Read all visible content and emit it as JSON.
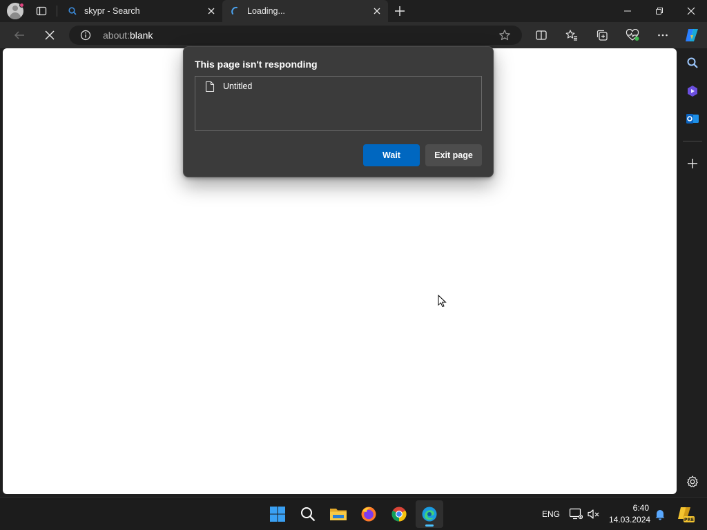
{
  "browser": {
    "tabs": [
      {
        "title": "skypr - Search",
        "favicon": "search-icon",
        "active": false
      },
      {
        "title": "Loading...",
        "favicon": "loading-spinner-icon",
        "active": true
      }
    ],
    "address": {
      "protocol": "about:",
      "rest": "blank"
    },
    "accent": "#0067c0"
  },
  "dialog": {
    "title": "This page isn't responding",
    "items": [
      {
        "label": "Untitled",
        "icon": "document-icon"
      }
    ],
    "wait_label": "Wait",
    "exit_label": "Exit page"
  },
  "taskbar": {
    "apps": [
      "start-icon",
      "search-icon",
      "file-explorer-icon",
      "firefox-icon",
      "chrome-icon",
      "edge-icon"
    ],
    "language": "ENG",
    "time": "6:40",
    "date": "14.03.2024"
  }
}
